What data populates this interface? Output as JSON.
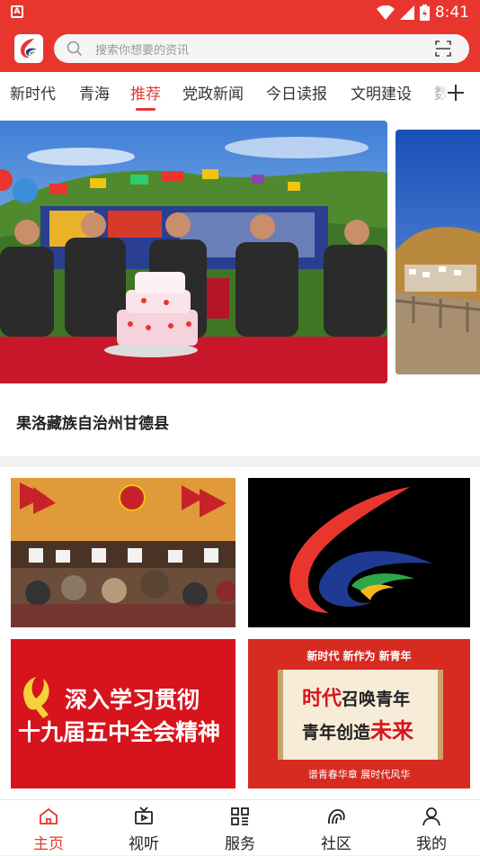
{
  "status_bar": {
    "time": "8:41"
  },
  "search": {
    "placeholder": "搜索你想要的资讯"
  },
  "tabs": [
    {
      "label": "新时代"
    },
    {
      "label": "青海"
    },
    {
      "label": "推荐"
    },
    {
      "label": "党政新闻"
    },
    {
      "label": "今日读报"
    },
    {
      "label": "文明建设"
    },
    {
      "label": "数"
    }
  ],
  "active_tab": "推荐",
  "banner": {
    "caption": "果洛藏族自治州甘德县"
  },
  "tiles": {
    "tile3_line1": "深入学习贯彻",
    "tile3_line2": "十九届五中全会精神",
    "tile4_top": "新时代 新作为 新青年",
    "tile4_line1_a": "时代",
    "tile4_line1_b": "召唤青年",
    "tile4_line2_a": "青年创造",
    "tile4_line2_b": "未来",
    "tile4_bottom": "谱青春华章 展时代风华"
  },
  "nav": [
    {
      "label": "主页",
      "icon": "home-icon"
    },
    {
      "label": "视听",
      "icon": "tv-icon"
    },
    {
      "label": "服务",
      "icon": "grid-icon"
    },
    {
      "label": "社区",
      "icon": "community-icon"
    },
    {
      "label": "我的",
      "icon": "user-icon"
    }
  ],
  "colors": {
    "brand": "#e8362f",
    "active_nav": "#e8362f"
  }
}
